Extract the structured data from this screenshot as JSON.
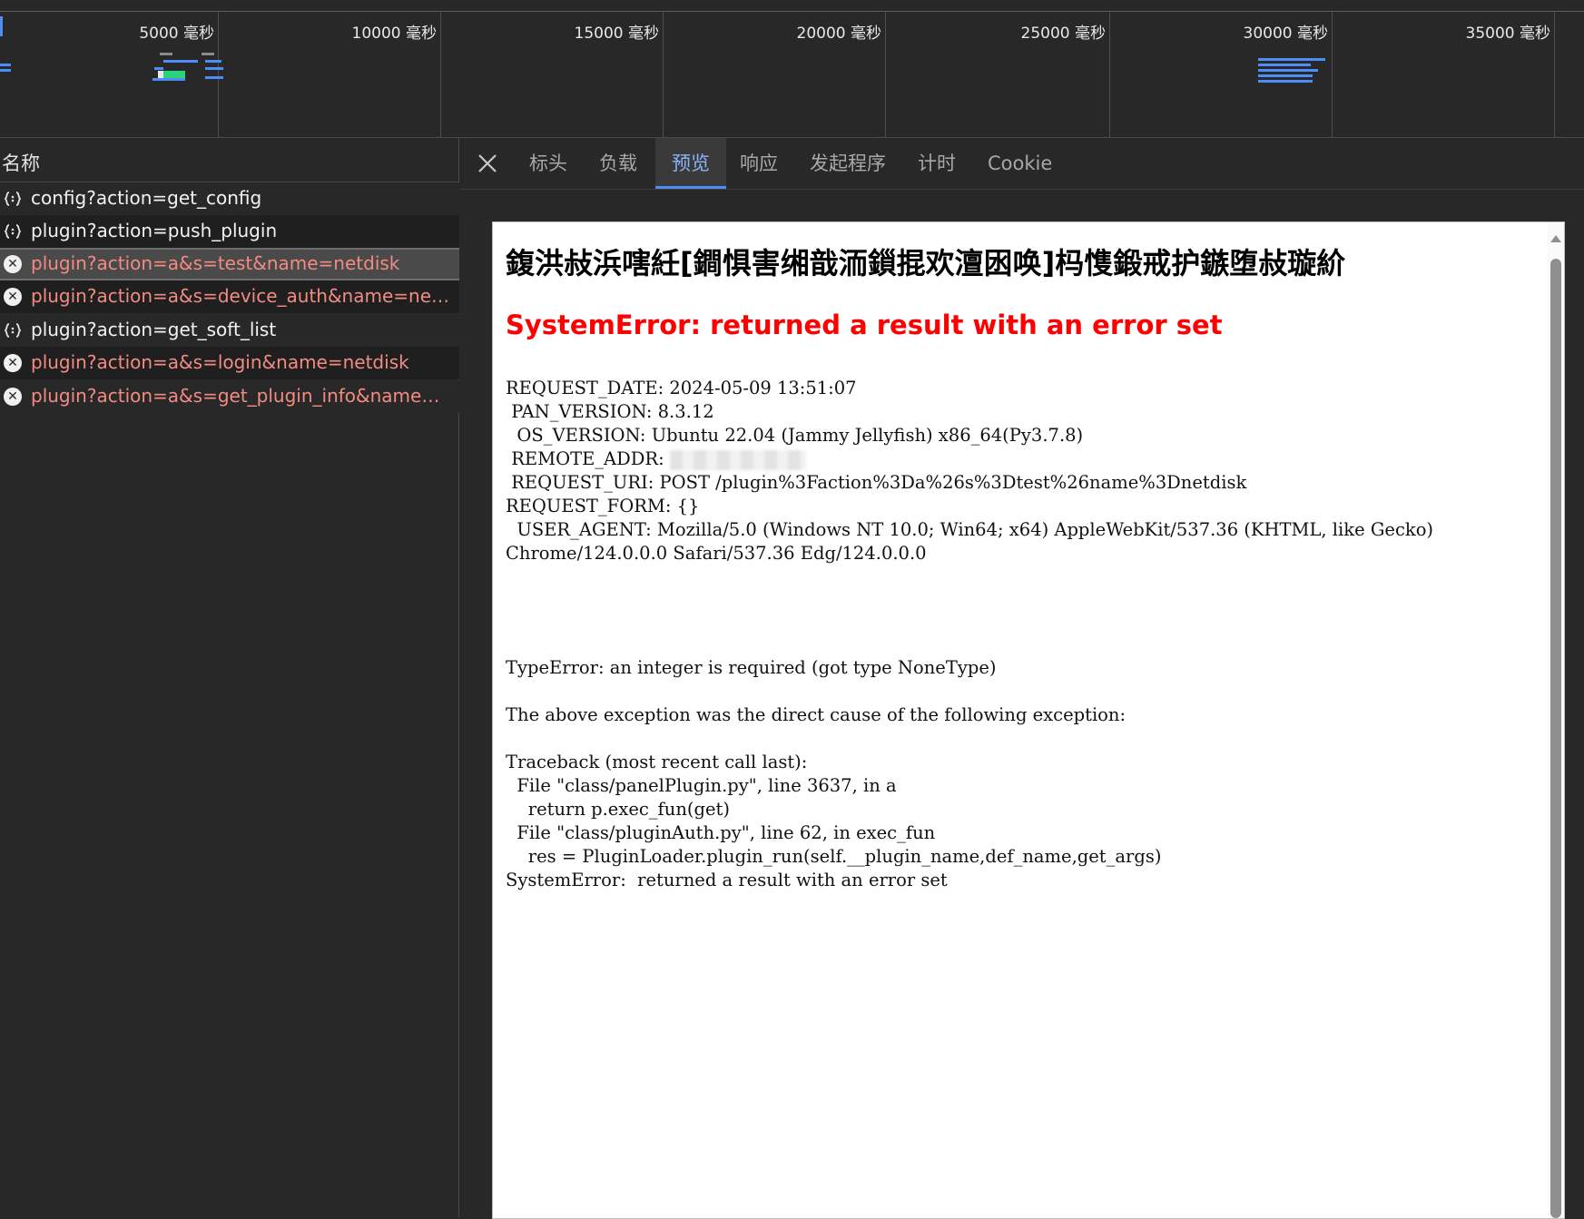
{
  "timeline": {
    "ticks": [
      "5000 毫秒",
      "10000 毫秒",
      "15000 毫秒",
      "20000 毫秒",
      "25000 毫秒",
      "30000 毫秒",
      "35000 毫秒"
    ]
  },
  "list": {
    "header": "名称",
    "rows": [
      {
        "name": "config?action=get_config",
        "status": "ok",
        "icon": "json-braces-icon"
      },
      {
        "name": "plugin?action=push_plugin",
        "status": "ok",
        "icon": "json-braces-icon"
      },
      {
        "name": "plugin?action=a&s=test&name=netdisk",
        "status": "error",
        "icon": "error-circle-icon",
        "selected": true
      },
      {
        "name": "plugin?action=a&s=device_auth&name=netdisk",
        "status": "error",
        "icon": "error-circle-icon"
      },
      {
        "name": "plugin?action=get_soft_list",
        "status": "ok",
        "icon": "json-braces-icon"
      },
      {
        "name": "plugin?action=a&s=login&name=netdisk",
        "status": "error",
        "icon": "error-circle-icon"
      },
      {
        "name": "plugin?action=a&s=get_plugin_info&name=net...",
        "status": "error",
        "icon": "error-circle-icon"
      }
    ]
  },
  "tabs": {
    "headers": "标头",
    "payload": "负载",
    "preview": "预览",
    "response": "响应",
    "initiator": "发起程序",
    "timing": "计时",
    "cookie": "Cookie",
    "active": "preview"
  },
  "preview": {
    "title": "鍑洪敊浜嗐紝[鐧惧害缃戠洏鎻掍欢澶囦唤]杩愯鍛戒护鏃堕敊璇紒",
    "error_heading": "SystemError: returned a result with an error set",
    "request": {
      "request_date_label": "REQUEST_DATE:",
      "request_date": "2024-05-09 13:51:07",
      "pan_version_label": " PAN_VERSION:",
      "pan_version": "8.3.12",
      "os_version_label": "  OS_VERSION:",
      "os_version": "Ubuntu 22.04 (Jammy Jellyfish) x86_64(Py3.7.8)",
      "remote_addr_label": " REMOTE_ADDR:",
      "request_uri_label": " REQUEST_URI:",
      "request_uri": "POST /plugin%3Faction%3Da%26s%3Dtest%26name%3Dnetdisk",
      "request_form_label": "REQUEST_FORM:",
      "request_form": "{}",
      "user_agent_label": "  USER_AGENT:",
      "user_agent": "Mozilla/5.0 (Windows NT 10.0; Win64; x64) AppleWebKit/537.36 (KHTML, like Gecko)",
      "user_agent_cont": "Chrome/124.0.0.0 Safari/537.36 Edg/124.0.0.0"
    },
    "traceback": {
      "type_error": "TypeError: an integer is required (got type NoneType)",
      "cause": "The above exception was the direct cause of the following exception:",
      "tb_head": "Traceback (most recent call last):",
      "line1": "  File \"class/panelPlugin.py\", line 3637, in a",
      "line2": "    return p.exec_fun(get)",
      "line3": "  File \"class/pluginAuth.py\", line 62, in exec_fun",
      "line4": "    res = PluginLoader.plugin_run(self.__plugin_name,def_name,get_args)",
      "line5": "SystemError:  returned a result with an error set"
    }
  },
  "colors": {
    "background": "#282828",
    "error_text": "#f28b82",
    "accent": "#8ab4f8",
    "heading_red": "#ff0000"
  }
}
